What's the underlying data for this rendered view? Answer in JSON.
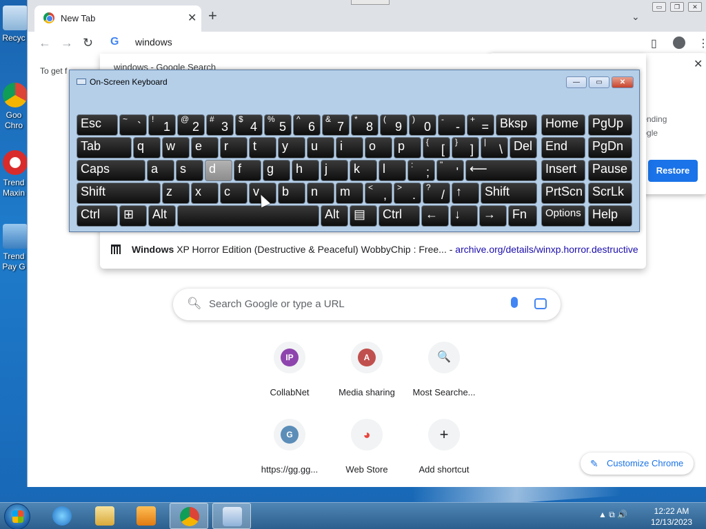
{
  "desktop": {
    "icons": [
      {
        "label": "Recyc",
        "name": "recycle-bin-icon"
      },
      {
        "label": "Goo Chro",
        "name": "google-chrome-icon"
      },
      {
        "label": "Trend Maxin",
        "name": "trend-micro-icon"
      },
      {
        "label": "Trend Pay G",
        "name": "trend-pay-guard-icon"
      }
    ]
  },
  "chrome": {
    "tab_title": "New Tab",
    "tab_close": "✕",
    "new_tab": "+",
    "tabs_dropdown": "⌄",
    "window_buttons": {
      "minimize": "▭",
      "maximize": "❐",
      "close": "✕"
    },
    "nav": {
      "back": "←",
      "forward": "→",
      "reload": "↻"
    },
    "omnibox_text": "windows",
    "google_g": "G",
    "bookmark_text": "To get f",
    "suggestion_1": "windows - Google Search",
    "suggestion_2": {
      "bold": "Windows",
      "rest": " XP Horror Edition (Destructive & Peaceful) WobbyChip : Free...",
      "sep": "  -  ",
      "url": "archive.org/details/winxp.horror.destructive"
    },
    "restore": {
      "text_line_1": "r by sending",
      "text_line_2": "to Google",
      "button": "Restore",
      "close": "✕"
    },
    "search_placeholder": "Search Google or type a URL",
    "shortcuts": [
      {
        "label": "CollabNet",
        "letter": "IP",
        "color": "#8e44ad"
      },
      {
        "label": "Media sharing",
        "letter": "A",
        "color": "#c0504d"
      },
      {
        "label": "Most Searche...",
        "letter": "🔍",
        "color": "#f1f3f4"
      },
      {
        "label": "https://gg.gg...",
        "letter": "G",
        "color": "#5b8db8"
      },
      {
        "label": "Web Store",
        "letter": "◕",
        "color": "#f1f3f4"
      },
      {
        "label": "Add shortcut",
        "letter": "+",
        "color": "#f1f3f4"
      }
    ],
    "customize_label": "Customize Chrome",
    "customize_icon": "✎"
  },
  "osk": {
    "title": "On-Screen Keyboard",
    "buttons": {
      "minimize": "—",
      "restore": "▭",
      "close": "✕"
    },
    "rows": [
      [
        {
          "main": "Esc",
          "w": "1.3"
        },
        {
          "shift": "~",
          "base": "`"
        },
        {
          "shift": "!",
          "base": "1"
        },
        {
          "shift": "@",
          "base": "2"
        },
        {
          "shift": "#",
          "base": "3"
        },
        {
          "shift": "$",
          "base": "4"
        },
        {
          "shift": "%",
          "base": "5"
        },
        {
          "shift": "^",
          "base": "6"
        },
        {
          "shift": "&",
          "base": "7"
        },
        {
          "shift": "*",
          "base": "8"
        },
        {
          "shift": "(",
          "base": "9"
        },
        {
          "shift": ")",
          "base": "0"
        },
        {
          "shift": "-",
          "base": "-"
        },
        {
          "shift": "+",
          "base": "="
        },
        {
          "main": "Bksp"
        }
      ],
      [
        {
          "main": "Tab"
        },
        {
          "main": "q"
        },
        {
          "main": "w"
        },
        {
          "main": "e"
        },
        {
          "main": "r"
        },
        {
          "main": "t"
        },
        {
          "main": "y"
        },
        {
          "main": "u"
        },
        {
          "main": "i"
        },
        {
          "main": "o"
        },
        {
          "main": "p"
        },
        {
          "shift": "{",
          "base": "["
        },
        {
          "shift": "}",
          "base": "]"
        },
        {
          "shift": "|",
          "base": "\\"
        },
        {
          "main": "Del"
        }
      ],
      [
        {
          "main": "Caps"
        },
        {
          "main": "a"
        },
        {
          "main": "s"
        },
        {
          "main": "d"
        },
        {
          "main": "f"
        },
        {
          "main": "g"
        },
        {
          "main": "h"
        },
        {
          "main": "j"
        },
        {
          "main": "k"
        },
        {
          "main": "l"
        },
        {
          "shift": ":",
          "base": ";"
        },
        {
          "shift": "\"",
          "base": "'"
        },
        {
          "main": "⟵"
        }
      ],
      [
        {
          "main": "Shift"
        },
        {
          "main": "z"
        },
        {
          "main": "x"
        },
        {
          "main": "c"
        },
        {
          "main": "v"
        },
        {
          "main": "b"
        },
        {
          "main": "n"
        },
        {
          "main": "m"
        },
        {
          "shift": "<",
          "base": ","
        },
        {
          "shift": ">",
          "base": "."
        },
        {
          "shift": "?",
          "base": "/"
        },
        {
          "main": "↑"
        },
        {
          "main": "Shift"
        }
      ],
      [
        {
          "main": "Ctrl"
        },
        {
          "main": "⊞"
        },
        {
          "main": "Alt"
        },
        {
          "main": ""
        },
        {
          "main": "Alt"
        },
        {
          "main": "▤"
        },
        {
          "main": "Ctrl"
        },
        {
          "main": "←"
        },
        {
          "main": "↓"
        },
        {
          "main": "→"
        },
        {
          "main": "Fn"
        }
      ]
    ],
    "nav_keys": [
      [
        "Home",
        "PgUp"
      ],
      [
        "End",
        "PgDn"
      ],
      [
        "Insert",
        "Pause"
      ],
      [
        "PrtScn",
        "ScrLk"
      ],
      [
        "Options",
        "Help"
      ]
    ]
  },
  "taskbar": {
    "tray_icons": "▲  ⧉  🔊",
    "time": "12:22 AM",
    "date": "12/13/2023"
  }
}
